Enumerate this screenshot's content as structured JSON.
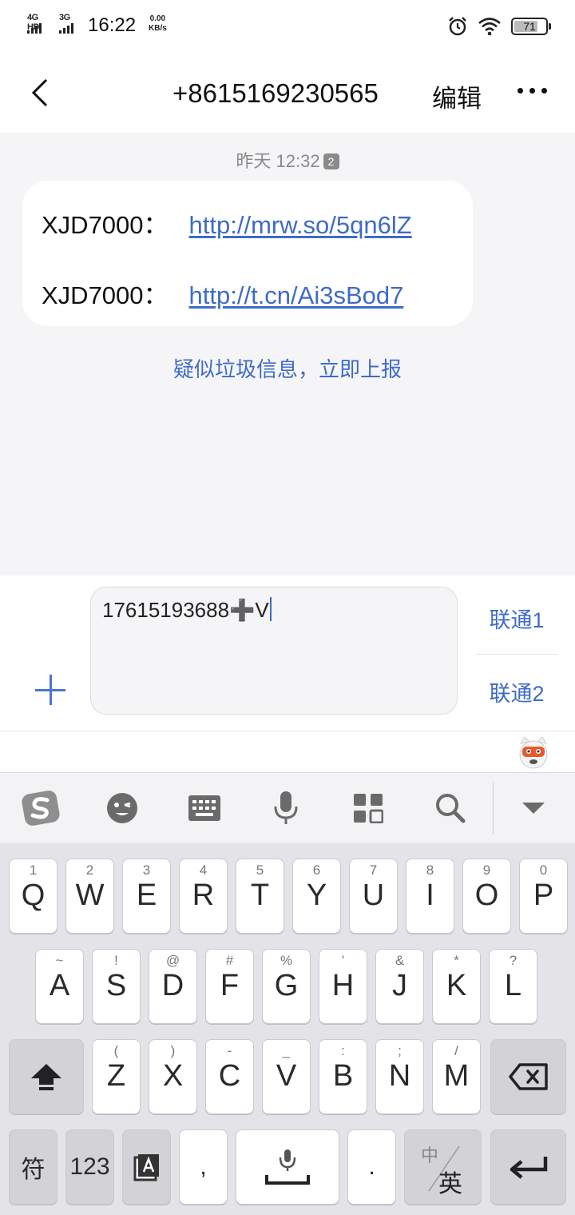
{
  "status_bar": {
    "net1_label": "4G HD",
    "net2_label": "3G",
    "time": "16:22",
    "speed_value": "0.00",
    "speed_unit": "KB/s",
    "battery_level": "71"
  },
  "header": {
    "title": "+8615169230565",
    "edit_label": "编辑"
  },
  "conversation": {
    "timestamp": "昨天 12:32",
    "timestamp_badge": "2",
    "messages": [
      {
        "sender": "XJD7000：",
        "link": "http://mrw.so/5qn6lZ"
      },
      {
        "sender": "XJD7000：",
        "link": "http://t.cn/Ai3sBod7"
      }
    ],
    "spam_report": "疑似垃圾信息，立即上报"
  },
  "compose": {
    "input_value": "17615193688➕V",
    "sim1_label": "联通1",
    "sim2_label": "联通2"
  },
  "keyboard": {
    "row1": [
      {
        "main": "Q",
        "sub": "1"
      },
      {
        "main": "W",
        "sub": "2"
      },
      {
        "main": "E",
        "sub": "3"
      },
      {
        "main": "R",
        "sub": "4"
      },
      {
        "main": "T",
        "sub": "5"
      },
      {
        "main": "Y",
        "sub": "6"
      },
      {
        "main": "U",
        "sub": "7"
      },
      {
        "main": "I",
        "sub": "8"
      },
      {
        "main": "O",
        "sub": "9"
      },
      {
        "main": "P",
        "sub": "0"
      }
    ],
    "row2": [
      {
        "main": "A",
        "sub": "~"
      },
      {
        "main": "S",
        "sub": "!"
      },
      {
        "main": "D",
        "sub": "@"
      },
      {
        "main": "F",
        "sub": "#"
      },
      {
        "main": "G",
        "sub": "%"
      },
      {
        "main": "H",
        "sub": "'"
      },
      {
        "main": "J",
        "sub": "&"
      },
      {
        "main": "K",
        "sub": "*"
      },
      {
        "main": "L",
        "sub": "?"
      }
    ],
    "row3": [
      {
        "main": "Z",
        "sub": "("
      },
      {
        "main": "X",
        "sub": ")"
      },
      {
        "main": "C",
        "sub": "-"
      },
      {
        "main": "V",
        "sub": "_"
      },
      {
        "main": "B",
        "sub": ":"
      },
      {
        "main": "N",
        "sub": ";"
      },
      {
        "main": "M",
        "sub": "/"
      }
    ],
    "symbol_label": "符",
    "numeric_label": "123",
    "comma_label": ",",
    "period_label": ".",
    "lang_top_label": "中",
    "lang_bottom_label": "英"
  },
  "colors": {
    "accent": "#3f6bc7",
    "background": "#f5f5f7",
    "sogou": "#8e8e8e"
  }
}
